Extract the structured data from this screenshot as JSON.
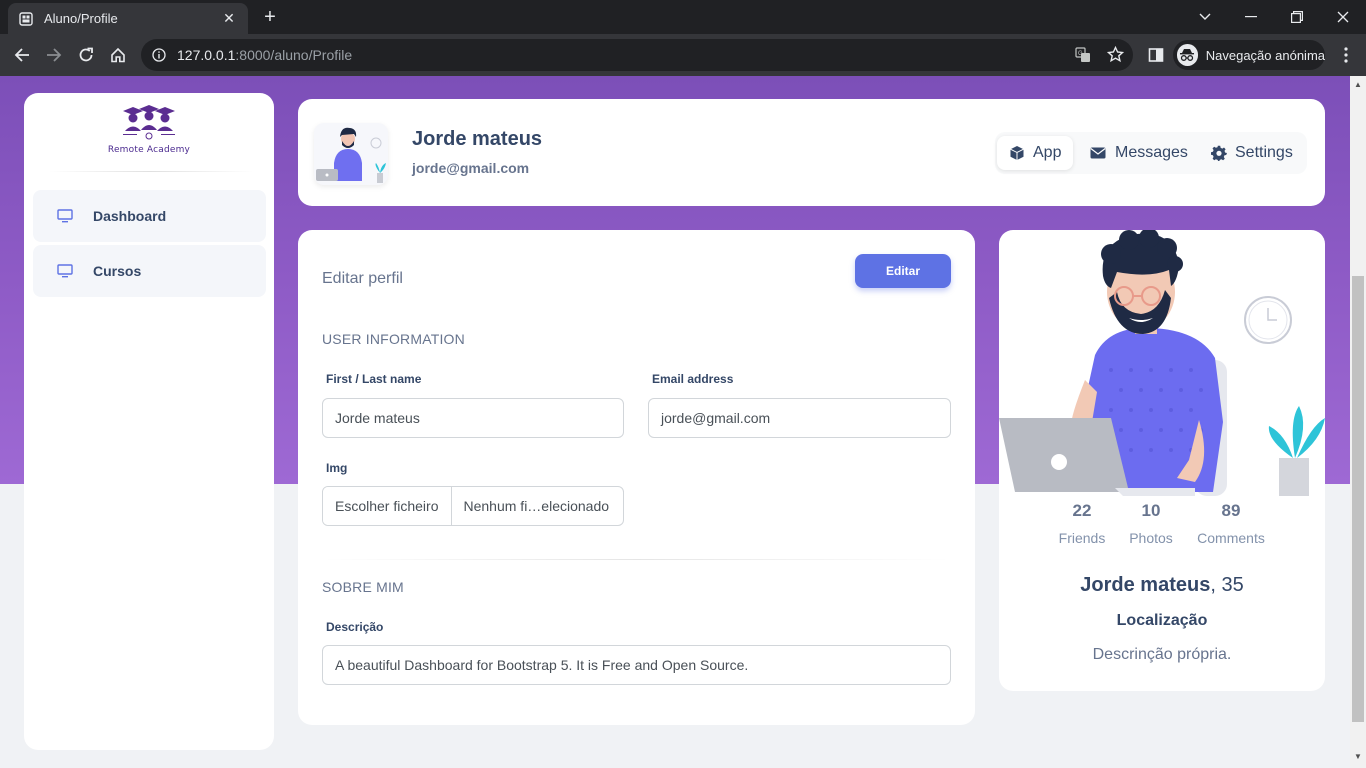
{
  "browser": {
    "tab_title": "Aluno/Profile",
    "url_host": "127.0.0.1",
    "url_rest": ":8000/aluno/Profile",
    "incognito_label": "Navegação anónima"
  },
  "sidebar": {
    "logo_text": "Remote Academy",
    "items": [
      {
        "label": "Dashboard",
        "icon": "monitor-icon"
      },
      {
        "label": "Cursos",
        "icon": "monitor-icon"
      }
    ]
  },
  "header": {
    "name": "Jorde mateus",
    "email": "jorde@gmail.com",
    "tabs": [
      {
        "label": "App",
        "icon": "cube-icon",
        "active": true
      },
      {
        "label": "Messages",
        "icon": "envelope-icon",
        "active": false
      },
      {
        "label": "Settings",
        "icon": "gear-icon",
        "active": false
      }
    ]
  },
  "edit": {
    "title": "Editar perfil",
    "edit_button": "Editar",
    "user_info_title": "USER INFORMATION",
    "name_label": "First / Last name",
    "name_value": "Jorde mateus",
    "email_label": "Email address",
    "email_value": "jorde@gmail.com",
    "img_label": "Img",
    "file_button": "Escolher ficheiro",
    "file_status": "Nenhum fi…elecionado",
    "about_title": "SOBRE MIM",
    "desc_label": "Descrição",
    "desc_value": "A beautiful Dashboard for Bootstrap 5. It is Free and Open Source."
  },
  "profile_card": {
    "stats": [
      {
        "value": "22",
        "label": "Friends"
      },
      {
        "value": "10",
        "label": "Photos"
      },
      {
        "value": "89",
        "label": "Comments"
      }
    ],
    "name": "Jorde mateus",
    "age": ", 35",
    "location": "Localização",
    "description": "Descrinção própria."
  },
  "colors": {
    "banner": "#8e5bc6",
    "primary_button": "#5e72e4",
    "text_dark": "#344767",
    "text_muted": "#67748e"
  }
}
